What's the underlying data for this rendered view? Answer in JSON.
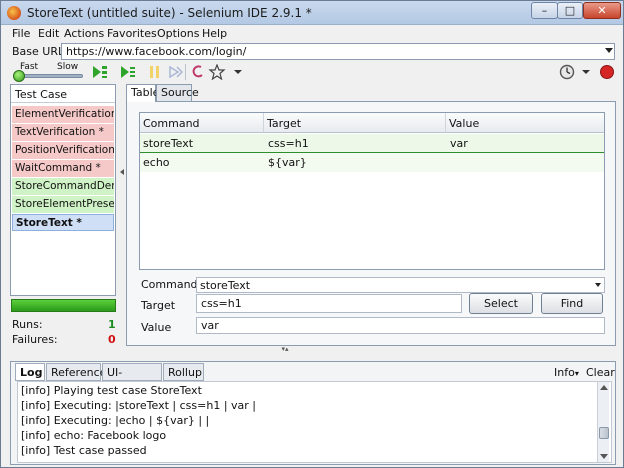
{
  "window": {
    "title": "StoreText (untitled suite) - Selenium IDE 2.9.1 *",
    "min_glyph": "–",
    "max_glyph": "□",
    "close_glyph": "✕"
  },
  "menu": [
    "File",
    "Edit",
    "Actions",
    "Favorites",
    "Options",
    "Help"
  ],
  "base_url": {
    "label": "Base URL",
    "value": "https://www.facebook.com/login/"
  },
  "speed": {
    "fast": "Fast",
    "slow": "Slow"
  },
  "test_cases": {
    "header": "Test Case",
    "items": [
      {
        "label": "ElementVerification *",
        "status": "fail"
      },
      {
        "label": "TextVerification *",
        "status": "fail"
      },
      {
        "label": "PositionVerification *",
        "status": "fail"
      },
      {
        "label": "WaitCommand *",
        "status": "fail"
      },
      {
        "label": "StoreCommandDem...",
        "status": "pass"
      },
      {
        "label": "StoreElementPresent *",
        "status": "pass"
      },
      {
        "label": "StoreText *",
        "status": "active"
      }
    ]
  },
  "stats": {
    "runs_label": "Runs:",
    "runs_value": "1",
    "failures_label": "Failures:",
    "failures_value": "0"
  },
  "tabs": {
    "table": "Table",
    "source": "Source"
  },
  "table": {
    "headers": [
      "Command",
      "Target",
      "Value"
    ],
    "rows": [
      {
        "command": "storeText",
        "target": "css=h1",
        "value": "var"
      },
      {
        "command": "echo",
        "target": "${var}",
        "value": ""
      }
    ]
  },
  "editor": {
    "command_label": "Command",
    "command_value": "storeText",
    "target_label": "Target",
    "target_value": "css=h1",
    "value_label": "Value",
    "value_value": "var",
    "select_button": "Select",
    "find_button": "Find"
  },
  "log": {
    "tabs": [
      "Log",
      "Reference",
      "UI-Element",
      "Rollup"
    ],
    "info_dropdown": "Info",
    "clear": "Clear",
    "lines": [
      "[info] Playing test case StoreText",
      "[info] Executing: |storeText | css=h1 | var |",
      "[info] Executing: |echo | ${var} | |",
      "[info] echo: Facebook logo",
      "[info] Test case passed"
    ]
  },
  "colors": {
    "fail": "#f6c9c9",
    "pass": "#cff2c6",
    "active": "#cfe0f6",
    "progress": "#3cb526"
  }
}
